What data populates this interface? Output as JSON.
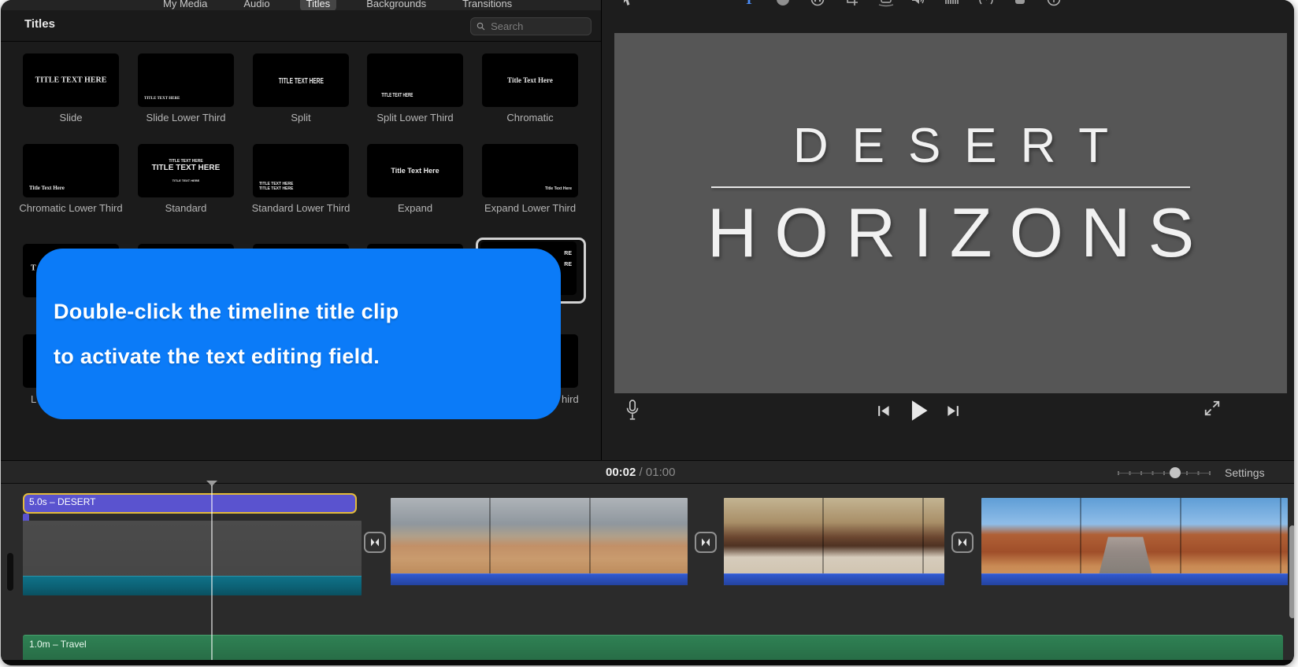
{
  "colors": {
    "tooltip_blue": "#0b7bf8",
    "title_clip_purple": "#5a53cf",
    "selection_yellow": "#e3bb3a",
    "music_green": "#2f8154",
    "audio_teal": "#0c6175",
    "audio_blue": "#2a4fba",
    "accent_text_blue": "#4b8df8"
  },
  "tabs": {
    "items": [
      {
        "label": "My Media",
        "selected": false
      },
      {
        "label": "Audio",
        "selected": false
      },
      {
        "label": "Titles",
        "selected": true
      },
      {
        "label": "Backgrounds",
        "selected": false
      },
      {
        "label": "Transitions",
        "selected": false
      }
    ]
  },
  "titles_panel": {
    "header": "Titles",
    "search_placeholder": "Search",
    "search_icon": "magnifier-icon"
  },
  "titles_grid": {
    "rows": [
      {
        "items": [
          {
            "label": "Slide",
            "preview_lines": [
              "TITLE TEXT HERE"
            ],
            "pos": "c",
            "font": "serif",
            "size": "md"
          },
          {
            "label": "Slide Lower Third",
            "preview_lines": [
              "TITLE TEXT HERE"
            ],
            "pos": "ll",
            "font": "serif",
            "size": "xxs"
          },
          {
            "label": "Split",
            "preview_lines": [
              "TITLE TEXT HERE"
            ],
            "pos": "c",
            "font": "cond",
            "size": "md"
          },
          {
            "label": "Split Lower Third",
            "preview_lines": [
              "TITLE TEXT HERE"
            ],
            "pos": "ll",
            "font": "cond",
            "size": "xs"
          },
          {
            "label": "Chromatic",
            "preview_lines": [
              "Title Text Here"
            ],
            "pos": "c",
            "font": "serif",
            "size": "sm"
          }
        ]
      },
      {
        "items": [
          {
            "label": "Chromatic Lower Third",
            "preview_lines": [
              "Title Text Here"
            ],
            "pos": "ll",
            "font": "serif",
            "size": "xs"
          },
          {
            "label": "Standard",
            "preview_lines": [
              "TITLE TEXT HERE",
              "TITLE TEXT HERE",
              "TITLE TEXT HERE"
            ],
            "pos": "c",
            "font": "sans",
            "size": "stack"
          },
          {
            "label": "Standard Lower Third",
            "preview_lines": [
              "TITLE TEXT HERE",
              "TITLE TEXT HERE"
            ],
            "pos": "ll",
            "font": "sans",
            "size": "xxs"
          },
          {
            "label": "Expand",
            "preview_lines": [
              "Title Text Here"
            ],
            "pos": "c",
            "font": "sans",
            "size": "sm"
          },
          {
            "label": "Expand Lower Third",
            "preview_lines": [
              "Title Text Here"
            ],
            "pos": "lr",
            "font": "sans",
            "size": "xxs"
          }
        ]
      },
      {
        "items": [
          {
            "label": "",
            "preview_lines": [
              "T"
            ],
            "pos": "lm",
            "font": "serif",
            "size": "md"
          },
          {
            "label": "",
            "preview_lines": [],
            "pos": "c",
            "font": "sans",
            "size": "md"
          },
          {
            "label": "",
            "preview_lines": [],
            "pos": "c",
            "font": "sans",
            "size": "md"
          },
          {
            "label": "",
            "preview_lines": [],
            "pos": "c",
            "font": "sans",
            "size": "md"
          },
          {
            "label": "",
            "preview_lines": [
              "RE",
              "RE"
            ],
            "pos": "rr",
            "font": "sans",
            "size": "xs",
            "selected": true
          }
        ]
      },
      {
        "items": [
          {
            "label": "",
            "preview_lines": [],
            "pos": "c",
            "font": "sans",
            "size": "md"
          },
          {
            "label": "",
            "preview_lines": [],
            "pos": "c",
            "font": "sans",
            "size": "md"
          },
          {
            "label": "",
            "preview_lines": [],
            "pos": "c",
            "font": "sans",
            "size": "md"
          },
          {
            "label": "",
            "preview_lines": [],
            "pos": "c",
            "font": "sans",
            "size": "md"
          },
          {
            "label": "",
            "preview_lines": [],
            "pos": "c",
            "font": "sans",
            "size": "md"
          }
        ]
      }
    ],
    "partially_visible_labels": {
      "row4_left_fragment": "L",
      "row4_right_fragment": "hird"
    }
  },
  "tooltip": {
    "line1": "Double-click the timeline title clip",
    "line2": "to activate the text editing field."
  },
  "viewer": {
    "toolbar_icons": [
      "pointer-icon",
      "text-style-icon",
      "color-correction-icon",
      "white-balance-icon",
      "crop-icon",
      "stabilization-icon",
      "volume-icon",
      "noise-reduction-icon",
      "speed-icon",
      "effects-icon",
      "info-icon"
    ],
    "title_line1": "DESERT",
    "title_line2": "HORIZONS",
    "controls": [
      "microphone-icon",
      "skip-back-icon",
      "play-icon",
      "skip-forward-icon",
      "fullscreen-icon"
    ]
  },
  "timeline_toolbar": {
    "current_time": "00:02",
    "separator": "/",
    "total_time": "01:00",
    "settings_label": "Settings",
    "zoom_slider": {
      "position_percent": 58
    }
  },
  "timeline": {
    "title_clip_label": "5.0s – DESERT",
    "music_clip_label": "1.0m – Travel",
    "clips": [
      {
        "kind": "gray-placeholder",
        "audio_strip": "teal"
      },
      {
        "kind": "desert-rocks-cloudy",
        "audio_strip": "blue"
      },
      {
        "kind": "desert-sunset-ridge",
        "audio_strip": "blue"
      },
      {
        "kind": "canyon-road-blue-sky",
        "audio_strip": "blue"
      }
    ],
    "transition_count": 3,
    "transition_icon": "bowtie-transition-icon"
  }
}
